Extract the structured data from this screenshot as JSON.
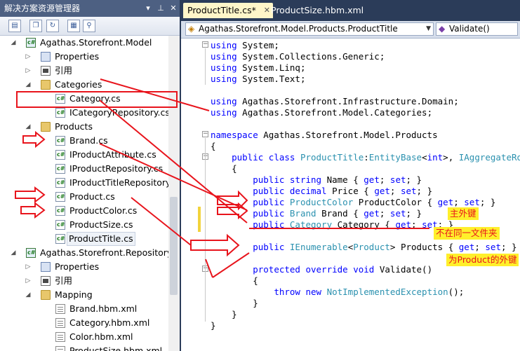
{
  "solution_explorer": {
    "title": "解决方案资源管理器",
    "title_buttons": [
      "▾",
      "⊥",
      "✕"
    ],
    "toolbar_icons": [
      "properties-icon",
      "show-all-files-icon",
      "refresh-icon",
      "view-class-diagram-icon",
      "view-code-icon"
    ],
    "items": [
      {
        "label": "Agathas.Storefront.Model",
        "icon": "csharp-project-icon",
        "expanded": true
      },
      {
        "label": "Properties",
        "icon": "properties-icon"
      },
      {
        "label": "引用",
        "icon": "references-icon"
      },
      {
        "label": "Categories",
        "icon": "folder-icon",
        "expanded": true
      },
      {
        "label": "Category.cs",
        "icon": "csharp-file-icon"
      },
      {
        "label": "ICategoryRepository.cs",
        "icon": "csharp-file-icon"
      },
      {
        "label": "Products",
        "icon": "folder-icon",
        "expanded": true
      },
      {
        "label": "Brand.cs",
        "icon": "csharp-file-icon"
      },
      {
        "label": "IProductAttribute.cs",
        "icon": "csharp-file-icon"
      },
      {
        "label": "IProductRepository.cs",
        "icon": "csharp-file-icon"
      },
      {
        "label": "IProductTitleRepository.c",
        "icon": "csharp-file-icon"
      },
      {
        "label": "Product.cs",
        "icon": "csharp-file-icon"
      },
      {
        "label": "ProductColor.cs",
        "icon": "csharp-file-icon"
      },
      {
        "label": "ProductSize.cs",
        "icon": "csharp-file-icon"
      },
      {
        "label": "ProductTitle.cs",
        "icon": "csharp-file-icon",
        "selected": true
      },
      {
        "label": "Agathas.Storefront.Repository.",
        "icon": "csharp-project-icon",
        "expanded": true
      },
      {
        "label": "Properties",
        "icon": "properties-icon"
      },
      {
        "label": "引用",
        "icon": "references-icon"
      },
      {
        "label": "Mapping",
        "icon": "folder-icon",
        "expanded": true
      },
      {
        "label": "Brand.hbm.xml",
        "icon": "xml-file-icon"
      },
      {
        "label": "Category.hbm.xml",
        "icon": "xml-file-icon"
      },
      {
        "label": "Color.hbm.xml",
        "icon": "xml-file-icon"
      },
      {
        "label": "ProductSize.hbm.xml",
        "icon": "xml-file-icon"
      }
    ]
  },
  "editor": {
    "tabs": [
      {
        "label": "ProductTitle.cs*",
        "active": true,
        "close": "✕"
      },
      {
        "label": "ProductSize.hbm.xml",
        "active": false
      }
    ],
    "type_dropdown": "Agathas.Storefront.Model.Products.ProductTitle",
    "member_dropdown": "Validate()",
    "code_lines": [
      [
        [
          "kw",
          "using"
        ],
        [
          "t",
          " System;"
        ]
      ],
      [
        [
          "kw",
          "using"
        ],
        [
          "t",
          " System.Collections.Generic;"
        ]
      ],
      [
        [
          "kw",
          "using"
        ],
        [
          "t",
          " System.Linq;"
        ]
      ],
      [
        [
          "kw",
          "using"
        ],
        [
          "t",
          " System.Text;"
        ]
      ],
      [],
      [
        [
          "kw",
          "using"
        ],
        [
          "t",
          " Agathas.Storefront.Infrastructure.Domain;"
        ]
      ],
      [
        [
          "kw",
          "using"
        ],
        [
          "t",
          " Agathas.Storefront.Model.Categories;"
        ]
      ],
      [],
      [
        [
          "kw",
          "namespace"
        ],
        [
          "t",
          " Agathas.Storefront.Model.Products"
        ]
      ],
      [
        [
          "t",
          "{"
        ]
      ],
      [
        [
          "t",
          "    "
        ],
        [
          "kw",
          "public class"
        ],
        [
          "t",
          " "
        ],
        [
          "ty",
          "ProductTitle"
        ],
        [
          "t",
          ":"
        ],
        [
          "ty",
          "EntityBase"
        ],
        [
          "t",
          "<"
        ],
        [
          "kw",
          "int"
        ],
        [
          "t",
          ">, "
        ],
        [
          "ty",
          "IAggregateRoot"
        ]
      ],
      [
        [
          "t",
          "    {"
        ]
      ],
      [
        [
          "t",
          "        "
        ],
        [
          "kw",
          "public string"
        ],
        [
          "t",
          " Name { "
        ],
        [
          "kw",
          "get"
        ],
        [
          "t",
          "; "
        ],
        [
          "kw",
          "set"
        ],
        [
          "t",
          "; }"
        ]
      ],
      [
        [
          "t",
          "        "
        ],
        [
          "kw",
          "public decimal"
        ],
        [
          "t",
          " Price { "
        ],
        [
          "kw",
          "get"
        ],
        [
          "t",
          "; "
        ],
        [
          "kw",
          "set"
        ],
        [
          "t",
          "; }"
        ]
      ],
      [
        [
          "t",
          "        "
        ],
        [
          "kw",
          "public"
        ],
        [
          "t",
          " "
        ],
        [
          "ty",
          "ProductColor"
        ],
        [
          "t",
          " ProductColor { "
        ],
        [
          "kw",
          "get"
        ],
        [
          "t",
          "; "
        ],
        [
          "kw",
          "set"
        ],
        [
          "t",
          "; }"
        ]
      ],
      [
        [
          "t",
          "        "
        ],
        [
          "kw",
          "public"
        ],
        [
          "t",
          " "
        ],
        [
          "ty",
          "Brand"
        ],
        [
          "t",
          " Brand { "
        ],
        [
          "kw",
          "get"
        ],
        [
          "t",
          "; "
        ],
        [
          "kw",
          "set"
        ],
        [
          "t",
          "; }"
        ]
      ],
      [
        [
          "t",
          "        "
        ],
        [
          "kw",
          "public"
        ],
        [
          "t",
          " "
        ],
        [
          "ty",
          "Category"
        ],
        [
          "t",
          " Category { "
        ],
        [
          "kw",
          "get"
        ],
        [
          "t",
          "; "
        ],
        [
          "kw",
          "set"
        ],
        [
          "t",
          "; }"
        ]
      ],
      [],
      [
        [
          "t",
          "        "
        ],
        [
          "kw",
          "public"
        ],
        [
          "t",
          " "
        ],
        [
          "ty",
          "IEnumerable"
        ],
        [
          "t",
          "<"
        ],
        [
          "ty",
          "Product"
        ],
        [
          "t",
          "> Products { "
        ],
        [
          "kw",
          "get"
        ],
        [
          "t",
          "; "
        ],
        [
          "kw",
          "set"
        ],
        [
          "t",
          "; }"
        ]
      ],
      [],
      [
        [
          "t",
          "        "
        ],
        [
          "kw",
          "protected override void"
        ],
        [
          "t",
          " Validate()"
        ]
      ],
      [
        [
          "t",
          "        {"
        ]
      ],
      [
        [
          "t",
          "            "
        ],
        [
          "kw",
          "throw new"
        ],
        [
          "t",
          " "
        ],
        [
          "ty",
          "NotImplementedException"
        ],
        [
          "t",
          "();"
        ]
      ],
      [
        [
          "t",
          "        }"
        ]
      ],
      [
        [
          "t",
          "    }"
        ]
      ],
      [
        [
          "t",
          "}"
        ]
      ]
    ]
  },
  "annotations": {
    "note_fk": "主外键",
    "note_folder": "不在同一文件夹",
    "note_product": "为Product的外键",
    "color": "#e8141c",
    "highlight": "#ffef2b"
  }
}
